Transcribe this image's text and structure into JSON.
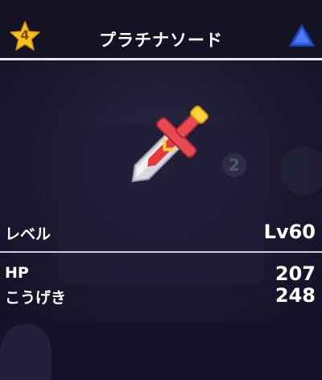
{
  "header": {
    "rank_badge": {
      "icon": "star-icon",
      "value": "4",
      "color": "#f5c21b"
    },
    "title": "プラチナソード",
    "menu_button": {
      "icon": "blue-triangle-icon",
      "color": "#2f5fe0"
    }
  },
  "item": {
    "icon": "platinum-sword-icon"
  },
  "background": {
    "badge_number": "2"
  },
  "stats": {
    "level": {
      "label": "レベル",
      "value": "Lv60"
    },
    "hp": {
      "label": "HP",
      "value": "207"
    },
    "attack": {
      "label": "こうげき",
      "value": "248"
    }
  },
  "colors": {
    "background": "#14132a",
    "divider": "#e8e8ee",
    "sword_red": "#e33a3e"
  }
}
